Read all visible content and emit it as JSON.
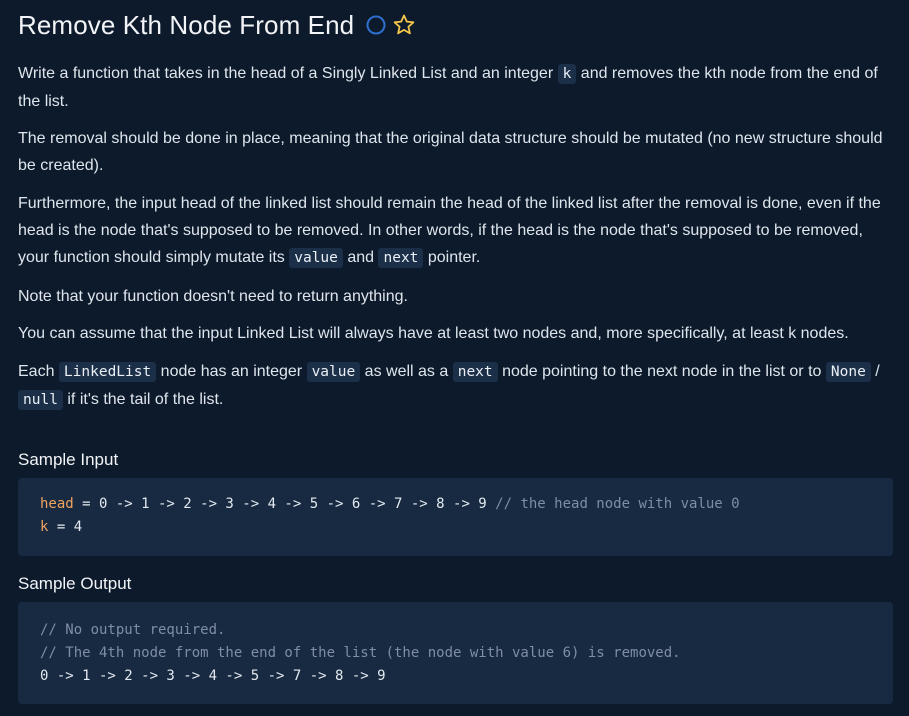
{
  "title": "Remove Kth Node From End",
  "icons": {
    "status": "circle-outline-icon",
    "favorite": "star-outline-icon",
    "status_color": "#2f6fd0",
    "favorite_color": "#f3c54b"
  },
  "description": {
    "p1": {
      "t1": "Write a function that takes in the head of a Singly Linked List and an integer ",
      "c1": "k",
      "t2": " and removes the kth node from the end of the list."
    },
    "p2": "The removal should be done in place, meaning that the original data structure should be mutated (no new structure should be created).",
    "p3": {
      "t1": "Furthermore, the input head of the linked list should remain the head of the linked list after the removal is done, even if the head is the node that's supposed to be removed. In other words, if the head is the node that's supposed to be removed, your function should simply mutate its ",
      "c1": "value",
      "t2": " and ",
      "c2": "next",
      "t3": " pointer."
    },
    "p4": "Note that your function doesn't need to return anything.",
    "p5": "You can assume that the input Linked List will always have at least two nodes and, more specifically, at least k nodes.",
    "p6": {
      "t1": "Each ",
      "c1": "LinkedList",
      "t2": " node has an integer ",
      "c2": "value",
      "t3": " as well as a ",
      "c3": "next",
      "t4": " node pointing to the next node in the list or to ",
      "c4": "None",
      "t5": " / ",
      "c5": "null",
      "t6": " if it's the tail of the list."
    }
  },
  "sample_input": {
    "heading": "Sample Input",
    "line1": {
      "var": "head",
      "rest": " = 0 -> 1 -> 2 -> 3 -> 4 -> 5 -> 6 -> 7 -> 8 -> 9 ",
      "comment": "// the head node with value 0"
    },
    "line2": {
      "var": "k",
      "rest": " = 4"
    }
  },
  "sample_output": {
    "heading": "Sample Output",
    "comment1": "// No output required.",
    "comment2": "// The 4th node from the end of the list (the node with value 6) is removed.",
    "line3": "0 -> 1 -> 2 -> 3 -> 4 -> 5 -> 7 -> 8 -> 9"
  }
}
